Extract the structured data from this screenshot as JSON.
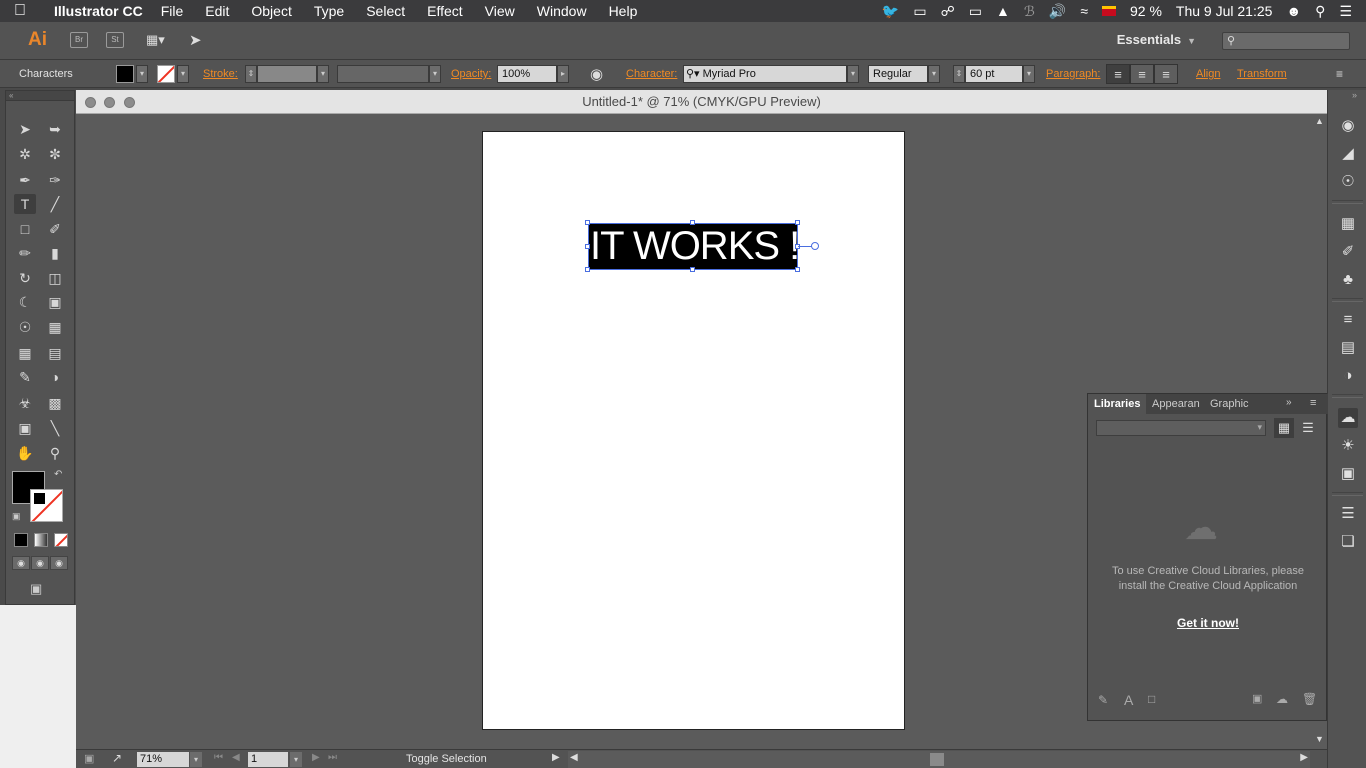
{
  "menubar": {
    "app_name": "Illustrator CC",
    "items": [
      "File",
      "Edit",
      "Object",
      "Type",
      "Select",
      "Effect",
      "View",
      "Window",
      "Help"
    ],
    "battery": "92 %",
    "clock": "Thu 9 Jul  21:25"
  },
  "appbar": {
    "logo": "Ai",
    "bridge": "Br",
    "stock": "St",
    "workspace": "Essentials"
  },
  "controlbar": {
    "panel_label": "Characters",
    "stroke_label": "Stroke:",
    "opacity_label": "Opacity:",
    "opacity_value": "100%",
    "character_label": "Character:",
    "font_family": "Myriad Pro",
    "font_style": "Regular",
    "font_size": "60 pt",
    "paragraph_label": "Paragraph:",
    "align_label": "Align",
    "transform_label": "Transform"
  },
  "document": {
    "title": "Untitled-1* @ 71% (CMYK/GPU Preview)",
    "text_content": "IT WORKS !!!"
  },
  "statusbar": {
    "zoom": "71%",
    "artboard": "1",
    "tool_status": "Toggle Selection"
  },
  "libraries": {
    "tabs": [
      "Libraries",
      "Appearan",
      "Graphic St"
    ],
    "message": "To use Creative Cloud Libraries, please install the Creative Cloud Application",
    "link": "Get it now!"
  },
  "colors": {
    "accent_orange": "#f08a24",
    "selection_blue": "#4a6ee0",
    "panel_gray": "#535353",
    "pasteboard": "#5b5b5b"
  }
}
